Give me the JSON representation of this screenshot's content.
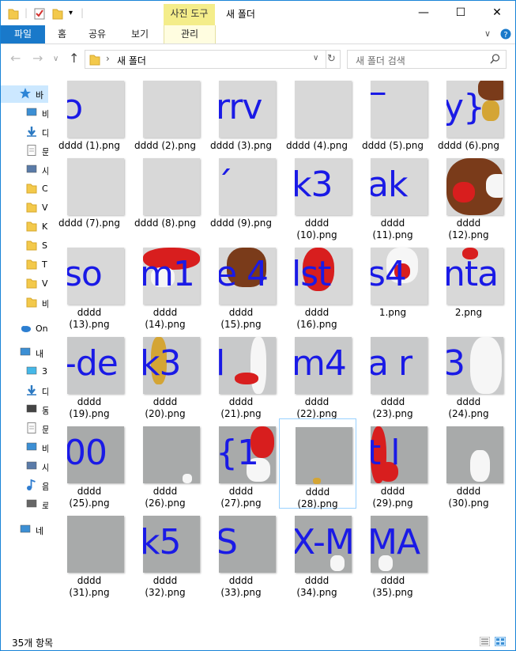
{
  "window": {
    "title": "새 폴더",
    "context_tab": "사진 도구",
    "minimize": "—",
    "maximize": "☐",
    "close": "✕"
  },
  "ribbon": {
    "tabs": [
      "파일",
      "홈",
      "공유",
      "보기",
      "관리"
    ],
    "file_color": "#1979ca"
  },
  "address": {
    "path_sep": "›",
    "path": "새 폴더",
    "search_placeholder": "새 폴더 검색"
  },
  "navpane": {
    "items": [
      {
        "label": "바",
        "icon": "star-icon"
      },
      {
        "label": "바",
        "icon": "desktop-icon"
      },
      {
        "label": "다",
        "icon": "download-icon"
      },
      {
        "label": "문",
        "icon": "document-icon"
      },
      {
        "label": "사",
        "icon": "picture-icon"
      },
      {
        "label": "C",
        "icon": "folder-icon"
      },
      {
        "label": "V",
        "icon": "folder-icon"
      },
      {
        "label": "K",
        "icon": "folder-icon"
      },
      {
        "label": "S",
        "icon": "folder-icon"
      },
      {
        "label": "T",
        "icon": "folder-icon"
      },
      {
        "label": "V",
        "icon": "folder-icon"
      },
      {
        "label": "바",
        "icon": "folder-icon"
      },
      {
        "label": "On",
        "icon": "cloud-icon"
      },
      {
        "label": "내",
        "icon": "computer-icon"
      },
      {
        "label": "3",
        "icon": "cube-icon"
      },
      {
        "label": "다",
        "icon": "download-icon"
      },
      {
        "label": "동",
        "icon": "video-icon"
      },
      {
        "label": "문",
        "icon": "document-icon"
      },
      {
        "label": "바",
        "icon": "desktop-icon"
      },
      {
        "label": "사",
        "icon": "picture-icon"
      },
      {
        "label": "음",
        "icon": "music-icon"
      },
      {
        "label": "로",
        "icon": "drive-icon"
      },
      {
        "label": "네",
        "icon": "network-icon"
      }
    ]
  },
  "files": [
    {
      "name": "dddd (1).png",
      "glyph": "ͻ",
      "tone": "light"
    },
    {
      "name": "dddd (2).png",
      "glyph": "",
      "tone": "light"
    },
    {
      "name": "dddd (3).png",
      "glyph": "rrv",
      "tone": "light"
    },
    {
      "name": "dddd (4).png",
      "glyph": "",
      "tone": "light"
    },
    {
      "name": "dddd (5).png",
      "glyph": "‾",
      "tone": "light"
    },
    {
      "name": "dddd (6).png",
      "glyph": "y}",
      "tone": "light"
    },
    {
      "name": "dddd (7).png",
      "glyph": "",
      "tone": "light"
    },
    {
      "name": "dddd (8).png",
      "glyph": "",
      "tone": "light"
    },
    {
      "name": "dddd (9).png",
      "glyph": "´",
      "tone": "light"
    },
    {
      "name": "dddd\n(10).png",
      "glyph": "k3",
      "tone": "light"
    },
    {
      "name": "dddd\n(11).png",
      "glyph": "ak",
      "tone": "light"
    },
    {
      "name": "dddd\n(12).png",
      "glyph": "",
      "tone": "light"
    },
    {
      "name": "dddd\n(13).png",
      "glyph": "so",
      "tone": "light"
    },
    {
      "name": "dddd\n(14).png",
      "glyph": "m1",
      "tone": "light"
    },
    {
      "name": "dddd\n(15).png",
      "glyph": "e 4",
      "tone": "light"
    },
    {
      "name": "dddd\n(16).png",
      "glyph": "lst",
      "tone": "light"
    },
    {
      "name": "1.png",
      "glyph": "s4",
      "tone": "light"
    },
    {
      "name": "2.png",
      "glyph": "nta",
      "tone": "light"
    },
    {
      "name": "dddd\n(19).png",
      "glyph": "-de",
      "tone": "mid"
    },
    {
      "name": "dddd\n(20).png",
      "glyph": "k3",
      "tone": "mid"
    },
    {
      "name": "dddd\n(21).png",
      "glyph": "  l",
      "tone": "mid"
    },
    {
      "name": "dddd\n(22).png",
      "glyph": "m4",
      "tone": "mid"
    },
    {
      "name": "dddd\n(23).png",
      "glyph": "a r",
      "tone": "mid"
    },
    {
      "name": "dddd\n(24).png",
      "glyph": "3",
      "tone": "mid"
    },
    {
      "name": "dddd\n(25).png",
      "glyph": "00",
      "tone": "dark"
    },
    {
      "name": "dddd\n(26).png",
      "glyph": "",
      "tone": "dark"
    },
    {
      "name": "dddd\n(27).png",
      "glyph": "{1",
      "tone": "dark"
    },
    {
      "name": "dddd\n(28).png",
      "glyph": "",
      "tone": "dark"
    },
    {
      "name": "dddd\n(29).png",
      "glyph": "t l",
      "tone": "dark"
    },
    {
      "name": "dddd\n(30).png",
      "glyph": "",
      "tone": "dark"
    },
    {
      "name": "dddd\n(31).png",
      "glyph": "",
      "tone": "dark"
    },
    {
      "name": "dddd\n(32).png",
      "glyph": "k5",
      "tone": "dark"
    },
    {
      "name": "dddd\n(33).png",
      "glyph": "S",
      "tone": "dark"
    },
    {
      "name": "dddd\n(34).png",
      "glyph": "X-M",
      "tone": "dark"
    },
    {
      "name": "dddd\n(35).png",
      "glyph": "MA",
      "tone": "dark"
    }
  ],
  "status": {
    "count": "35개 항목"
  }
}
